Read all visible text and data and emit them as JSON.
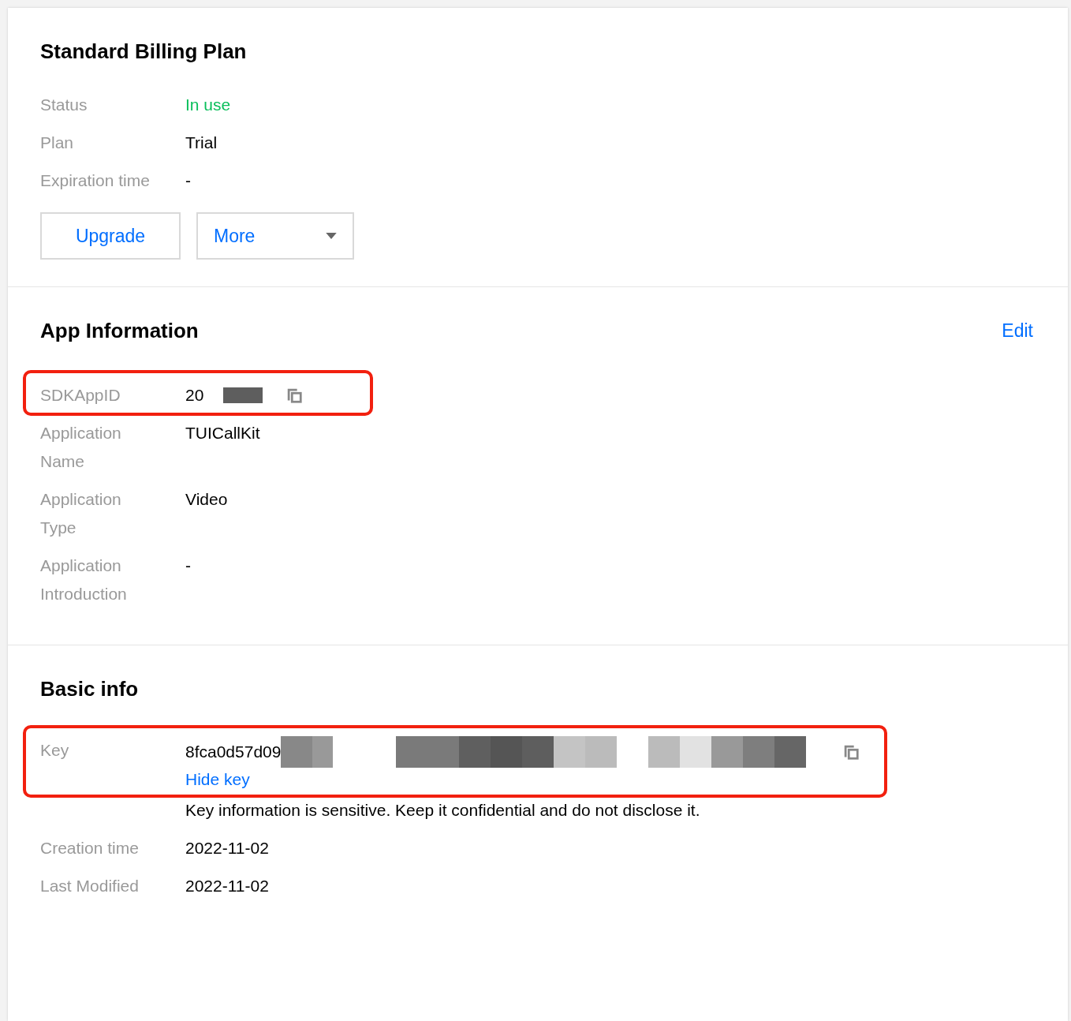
{
  "sections": [
    {
      "title": "Standard Billing Plan",
      "fields": [
        {
          "label": "Status",
          "value": "In use",
          "kind": "status"
        },
        {
          "label": "Plan",
          "value": "Trial",
          "kind": "text"
        },
        {
          "label": "Expiration time",
          "value": "-",
          "kind": "text"
        }
      ],
      "buttons": [
        {
          "label": "Upgrade",
          "kind": "button"
        },
        {
          "label": "More",
          "kind": "dropdown"
        }
      ]
    },
    {
      "title": "App Information",
      "action": "Edit",
      "fields": [
        {
          "label": "SDKAppID",
          "value": "20",
          "kind": "masked",
          "highlighted": true
        },
        {
          "label": "Application Name",
          "value": "TUICallKit",
          "kind": "text"
        },
        {
          "label": "Application Type",
          "value": "Video",
          "kind": "text"
        },
        {
          "label": "Application Introduction",
          "value": "-",
          "kind": "text"
        }
      ]
    },
    {
      "title": "Basic info",
      "fields": [
        {
          "label": "Key",
          "value": "8fca0d57d09",
          "kind": "key",
          "link": "Hide key",
          "note": "Key information is sensitive. Keep it confidential and do not disclose it.",
          "highlighted": true
        },
        {
          "label": "Creation time",
          "value": "2022-11-02",
          "kind": "text"
        },
        {
          "label": "Last Modified",
          "value": "2022-11-02",
          "kind": "text"
        }
      ]
    }
  ]
}
